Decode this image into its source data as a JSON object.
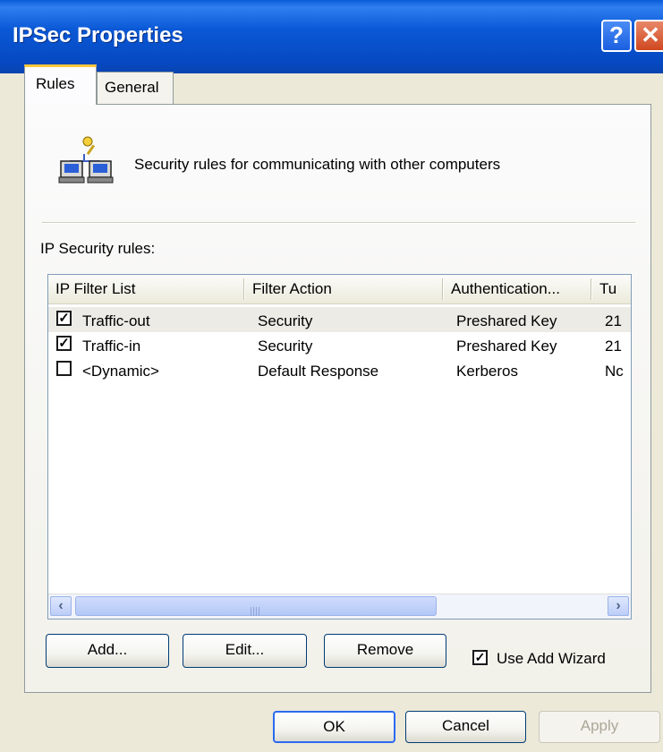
{
  "window": {
    "title": "IPSec Properties",
    "help_glyph": "?",
    "close_glyph": "✕"
  },
  "tabs": [
    {
      "label": "Rules",
      "active": true
    },
    {
      "label": "General",
      "active": false
    }
  ],
  "intro": {
    "icon": "network-computers-key-icon",
    "text": "Security rules for communicating with other computers"
  },
  "rules": {
    "label": "IP Security rules:",
    "columns": [
      "IP Filter List",
      "Filter Action",
      "Authentication...",
      "Tu"
    ],
    "rows": [
      {
        "checked": "☑",
        "filter_list": "Traffic-out",
        "filter_action": "Security",
        "authentication": "Preshared Key",
        "tunnel": "21"
      },
      {
        "checked": "☑",
        "filter_list": "Traffic-in",
        "filter_action": "Security",
        "authentication": "Preshared Key",
        "tunnel": "21"
      },
      {
        "checked": "☐",
        "filter_list": "<Dynamic>",
        "filter_action": "Default Response",
        "authentication": "Kerberos",
        "tunnel": "Nc"
      }
    ]
  },
  "buttons": {
    "add": "Add...",
    "edit": "Edit...",
    "remove": "Remove",
    "ok": "OK",
    "cancel": "Cancel",
    "apply": "Apply"
  },
  "wizard": {
    "label": "Use Add Wizard",
    "checked": true
  },
  "colors": {
    "titlebar": "#0a58d6",
    "dialog_bg": "#ece9d8",
    "active_tab_accent": "#ffc83c"
  }
}
